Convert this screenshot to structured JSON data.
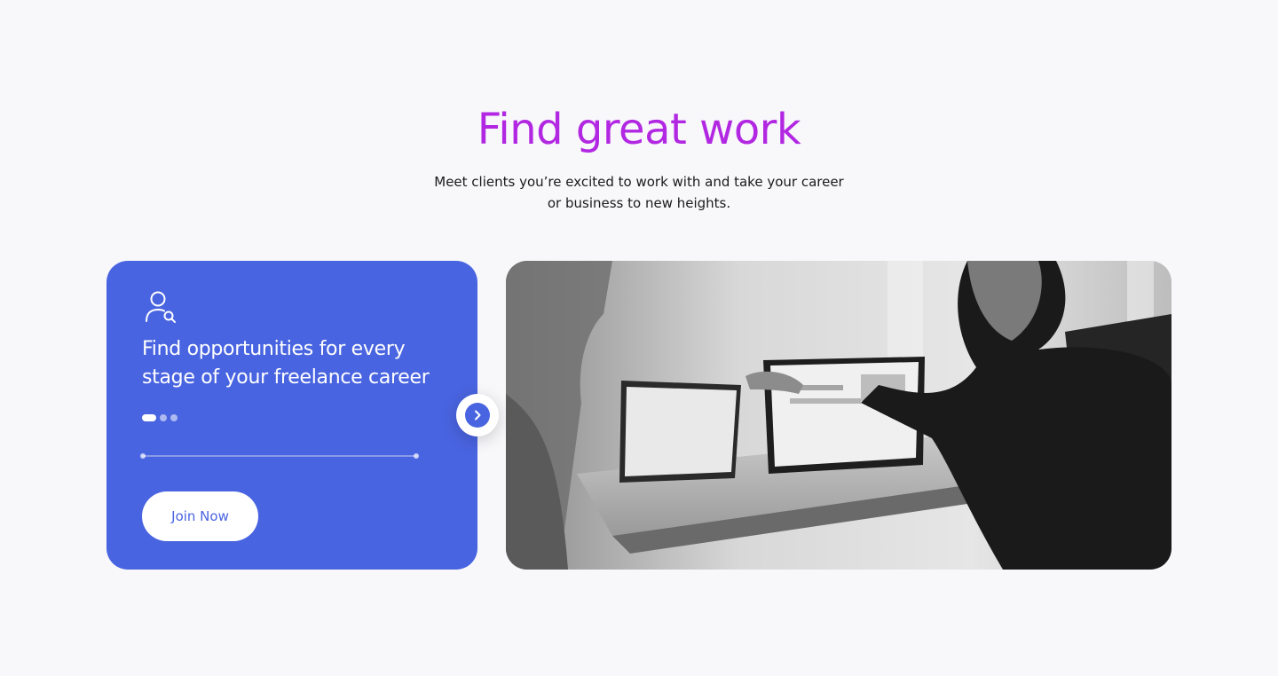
{
  "header": {
    "title": "Find great work",
    "subtitle": "Meet clients you’re excited to work with and take your career or business to new heights."
  },
  "promo_card": {
    "icon": "user-search-icon",
    "heading": "Find opportunities for every stage of your freelance career",
    "slides": {
      "total": 3,
      "active_index": 0
    },
    "cta_label": "Join Now",
    "accent_color": "#4964e0"
  },
  "carousel": {
    "next_icon": "chevron-right-icon"
  },
  "colors": {
    "title": "#b228e2",
    "card": "#4964e0",
    "background": "#f8f8fb"
  }
}
